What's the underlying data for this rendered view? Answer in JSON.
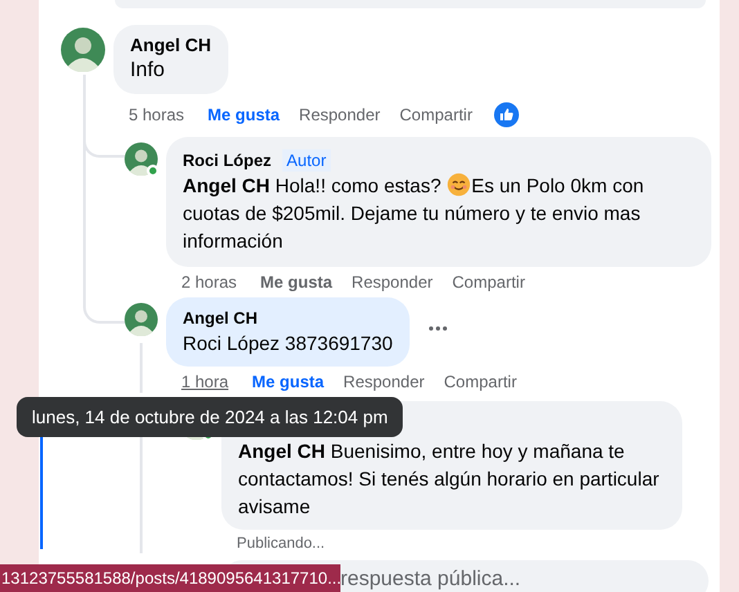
{
  "comments": [
    {
      "author": "Angel CH",
      "online": false,
      "highlight": false,
      "text": [
        {
          "kind": "text",
          "text": "Info"
        }
      ],
      "time": "5 horas",
      "time_underlined": false,
      "like_label": "Me gusta",
      "liked": true,
      "reply_label": "Responder",
      "share_label": "Compartir",
      "reaction_icon": true,
      "replies": [
        {
          "author": "Roci López",
          "author_badge": "Autor",
          "online": true,
          "highlight": false,
          "text": [
            {
              "kind": "text",
              "text": "**Angel CH** Hola!! como estas? "
            },
            {
              "kind": "emoji"
            },
            {
              "kind": "text",
              "text": "Es un Polo 0km con cuotas de $205mil. Dejame tu número y te envio mas información"
            }
          ],
          "time": "2 horas",
          "time_underlined": false,
          "like_label": "Me gusta",
          "liked": false,
          "reply_label": "Responder",
          "share_label": "Compartir"
        },
        {
          "author": "Angel CH",
          "online": false,
          "highlight": true,
          "text": [
            {
              "kind": "text",
              "text": "Roci López 3873691730"
            }
          ],
          "time": "1 hora",
          "time_underlined": true,
          "like_label": "Me gusta",
          "liked": true,
          "reply_label": "Responder",
          "share_label": "Compartir",
          "more_menu": true,
          "replies": [
            {
              "online": true,
              "highlight": false,
              "text": [
                {
                  "kind": "text",
                  "text": "**Angel CH** Buenisimo, entre hoy y mañana te contactamos! Si tenés algún horario en particular avisame"
                }
              ],
              "status": "Publicando..."
            }
          ]
        }
      ]
    }
  ],
  "reply_field": {
    "placeholder": "respuesta pública..."
  },
  "tooltip": "lunes, 14 de octubre de 2024 a las 12:04 pm",
  "status_url": "13123755581588/posts/4189095641317710..."
}
